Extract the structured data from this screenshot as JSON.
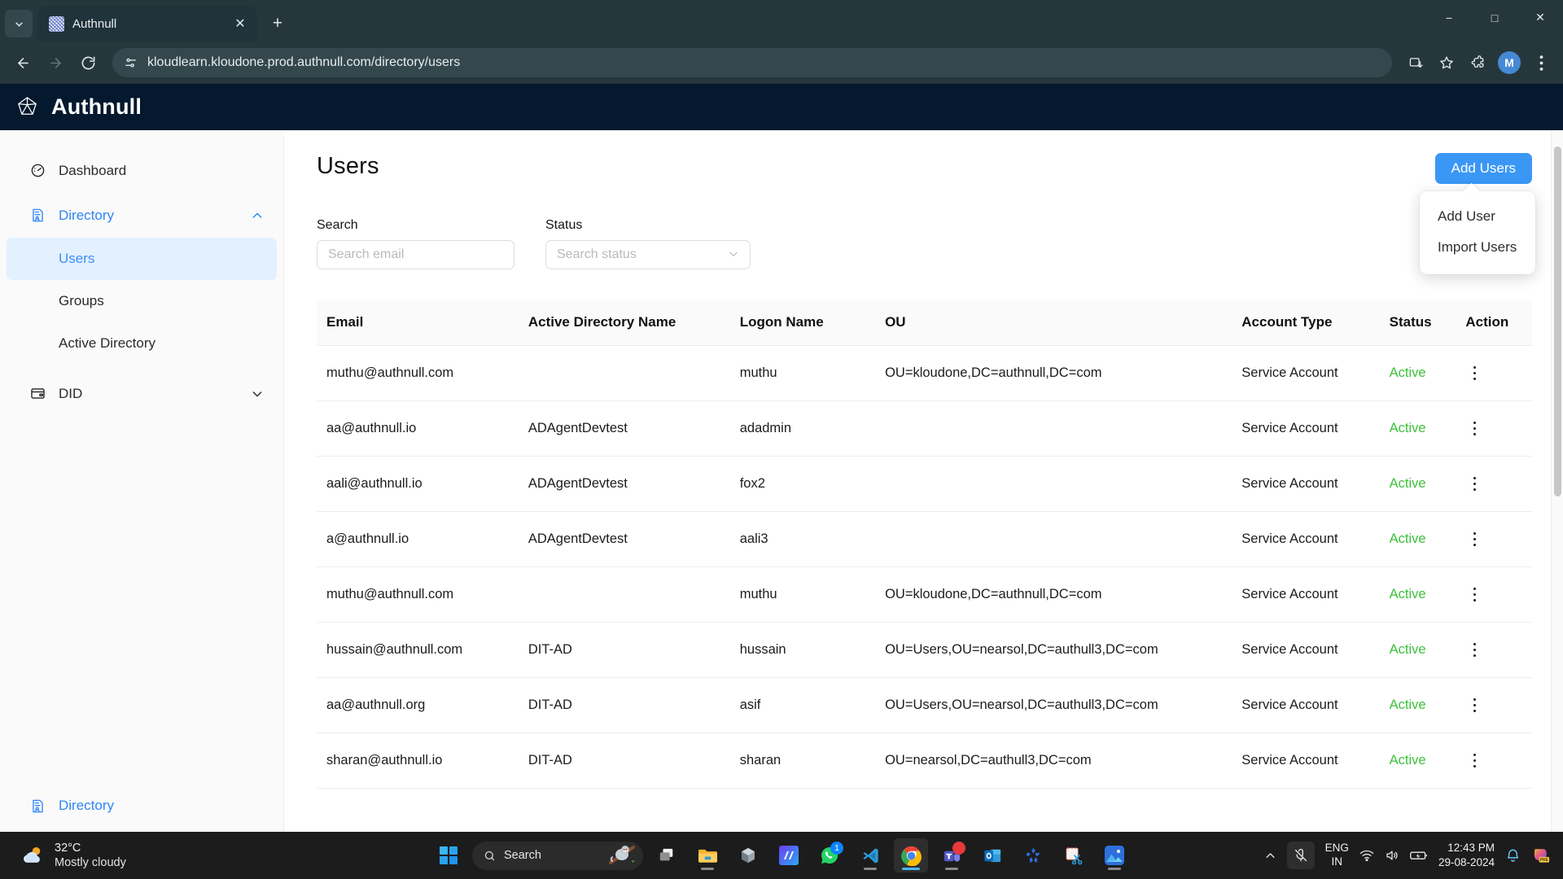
{
  "browser": {
    "tab": {
      "title": "Authnull",
      "favicon": "globe-favicon"
    },
    "url": "kloudlearn.kloudone.prod.authnull.com/directory/users",
    "profile_initial": "M",
    "window_controls": {
      "minimize": "−",
      "maximize": "□",
      "close": "✕"
    },
    "new_tab_label": "+",
    "close_tab_label": "✕"
  },
  "app": {
    "brand": "Authnull",
    "sidebar": {
      "items": [
        {
          "label": "Dashboard",
          "icon": "dashboard-icon"
        },
        {
          "label": "Directory",
          "icon": "directory-icon",
          "expanded": true
        },
        {
          "label": "DID",
          "icon": "card-icon",
          "expanded": false
        }
      ],
      "directory_children": [
        {
          "label": "Users",
          "selected": true
        },
        {
          "label": "Groups",
          "selected": false
        },
        {
          "label": "Active Directory",
          "selected": false
        }
      ],
      "footer": {
        "label": "Directory",
        "icon": "directory-icon"
      }
    },
    "page": {
      "title": "Users",
      "add_users_button": "Add Users",
      "add_users_menu": [
        "Add User",
        "Import Users"
      ],
      "filters": {
        "search": {
          "label": "Search",
          "placeholder": "Search email",
          "value": ""
        },
        "status": {
          "label": "Status",
          "placeholder": "Search status",
          "value": ""
        }
      },
      "table": {
        "columns": [
          "Email",
          "Active Directory Name",
          "Logon Name",
          "OU",
          "Account Type",
          "Status",
          "Action"
        ],
        "rows": [
          {
            "email": "muthu@authnull.com",
            "ad_name": "",
            "logon": "muthu",
            "ou": "OU=kloudone,DC=authnull,DC=com",
            "account_type": "Service Account",
            "status": "Active"
          },
          {
            "email": "aa@authnull.io",
            "ad_name": "ADAgentDevtest",
            "logon": "adadmin",
            "ou": "",
            "account_type": "Service Account",
            "status": "Active"
          },
          {
            "email": "aali@authnull.io",
            "ad_name": "ADAgentDevtest",
            "logon": "fox2",
            "ou": "",
            "account_type": "Service Account",
            "status": "Active"
          },
          {
            "email": "a@authnull.io",
            "ad_name": "ADAgentDevtest",
            "logon": "aali3",
            "ou": "",
            "account_type": "Service Account",
            "status": "Active"
          },
          {
            "email": "muthu@authnull.com",
            "ad_name": "",
            "logon": "muthu",
            "ou": "OU=kloudone,DC=authnull,DC=com",
            "account_type": "Service Account",
            "status": "Active"
          },
          {
            "email": "hussain@authnull.com",
            "ad_name": "DIT-AD",
            "logon": "hussain",
            "ou": "OU=Users,OU=nearsol,DC=authull3,DC=com",
            "account_type": "Service Account",
            "status": "Active"
          },
          {
            "email": "aa@authnull.org",
            "ad_name": "DIT-AD",
            "logon": "asif",
            "ou": "OU=Users,OU=nearsol,DC=authull3,DC=com",
            "account_type": "Service Account",
            "status": "Active"
          },
          {
            "email": "sharan@authnull.io",
            "ad_name": "DIT-AD",
            "logon": "sharan",
            "ou": "OU=nearsol,DC=authull3,DC=com",
            "account_type": "Service Account",
            "status": "Active"
          }
        ]
      }
    },
    "colors": {
      "accent": "#3b97f5",
      "brand_bar": "#04182e",
      "status_active": "#3cc13b",
      "sidebar_selected": "#e3f0fe"
    }
  },
  "taskbar": {
    "weather": {
      "temperature": "32°C",
      "condition": "Mostly cloudy"
    },
    "search_placeholder": "Search",
    "apps": [
      {
        "name": "task-view",
        "badge": ""
      },
      {
        "name": "file-explorer",
        "badge": ""
      },
      {
        "name": "blender",
        "badge": ""
      },
      {
        "name": "unknown-app",
        "badge": ""
      },
      {
        "name": "mediatek-app",
        "badge": ""
      },
      {
        "name": "whatsapp",
        "badge": "1"
      },
      {
        "name": "vs-code",
        "badge": ""
      },
      {
        "name": "google-chrome",
        "badge": ""
      },
      {
        "name": "microsoft-teams",
        "badge": "•"
      },
      {
        "name": "outlook",
        "badge": ""
      },
      {
        "name": "kubernetes",
        "badge": ""
      },
      {
        "name": "snipping-tool",
        "badge": ""
      },
      {
        "name": "photos",
        "badge": ""
      }
    ],
    "language": {
      "line1": "ENG",
      "line2": "IN"
    },
    "clock": {
      "time": "12:43 PM",
      "date": "29-08-2024"
    },
    "tray_icons": [
      "chevron-up-icon",
      "microphone-muted-icon",
      "wifi-icon",
      "speaker-icon",
      "battery-icon",
      "bell-icon",
      "copilot-icon"
    ]
  }
}
